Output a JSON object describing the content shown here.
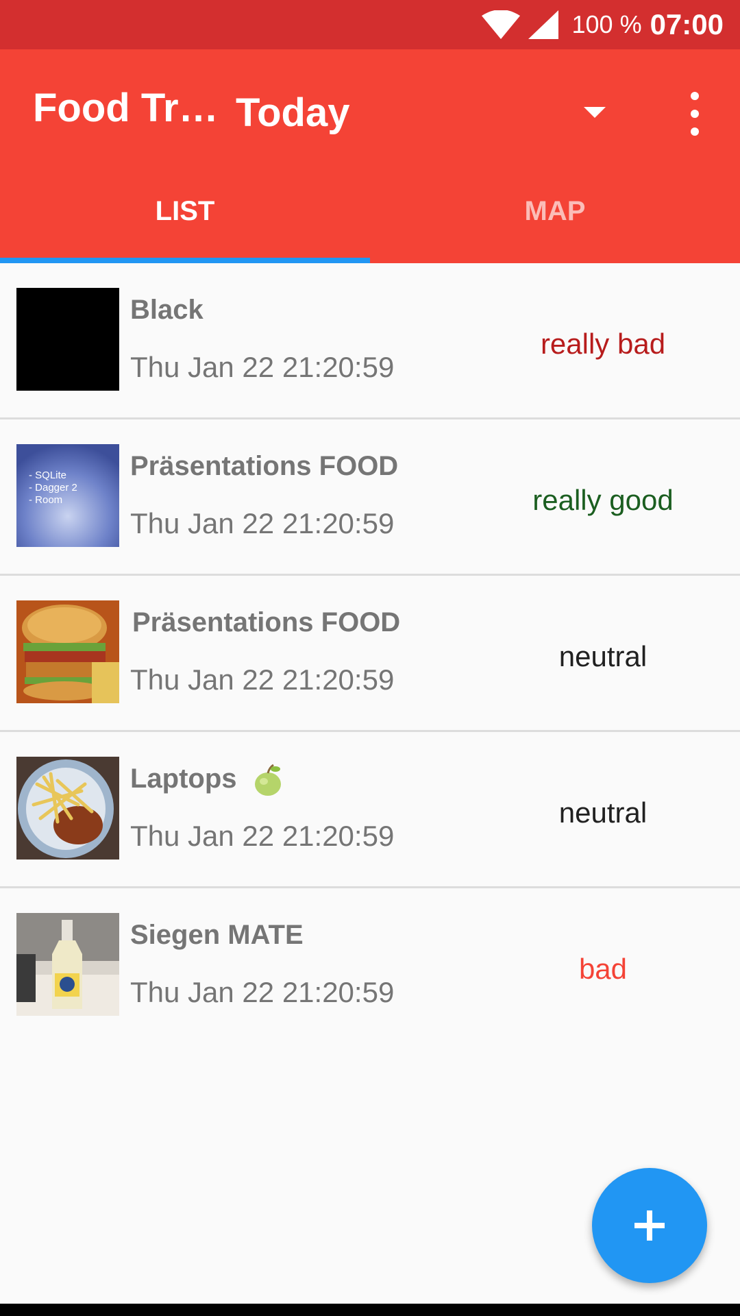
{
  "status_bar": {
    "battery": "100 %",
    "time": "07:00",
    "wifi_icon": "wifi-icon",
    "signal_icon": "cell-signal-icon"
  },
  "app_bar": {
    "title": "Food Tr…",
    "spinner_value": "Today",
    "spinner_icon": "dropdown-arrow-icon",
    "overflow_icon": "more-vert-icon"
  },
  "tabs": [
    {
      "label": "LIST",
      "active": true
    },
    {
      "label": "MAP",
      "active": false
    }
  ],
  "items": [
    {
      "name": "Black",
      "date": "Thu Jan 22 21:20:59",
      "rating": "really bad",
      "rating_color": "#b71c1c",
      "thumb": "black-square"
    },
    {
      "name": "Präsentations FOOD",
      "date": "Thu Jan 22 21:20:59",
      "rating": "really good",
      "rating_color": "#1b5e20",
      "thumb": "presentation-slide",
      "thumb_text": [
        "-  SQLite",
        "-  Dagger 2",
        "-  Room"
      ]
    },
    {
      "name": "Präsentations FOOD",
      "date": "Thu Jan 22 21:20:59",
      "rating": "neutral",
      "rating_color": "#212121",
      "thumb": "burger-photo"
    },
    {
      "name": "Laptops",
      "date": "Thu Jan 22 21:20:59",
      "rating": "neutral",
      "rating_color": "#212121",
      "thumb": "fries-photo",
      "emoji": "green-apple-icon"
    },
    {
      "name": "Siegen MATE",
      "date": "Thu Jan 22 21:20:59",
      "rating": "bad",
      "rating_color": "#f44336",
      "thumb": "bottle-photo"
    }
  ],
  "fab": {
    "icon": "plus-icon",
    "color": "#2196f3"
  },
  "colors": {
    "status_bar": "#d32f2f",
    "app_bar": "#f44336",
    "accent": "#2196f3"
  }
}
